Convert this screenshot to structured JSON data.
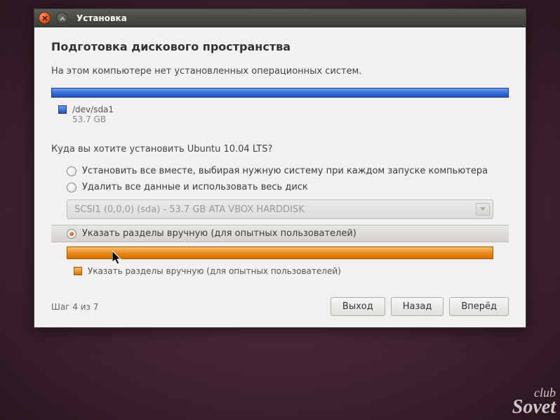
{
  "window": {
    "title": "Установка"
  },
  "header": "Подготовка дискового пространства",
  "info": "На этом компьютере нет установленных операционных систем.",
  "disk1_legend": {
    "device": "/dev/sda1",
    "size": "53.7 GB"
  },
  "question": "Куда вы хотите установить Ubuntu 10.04 LTS?",
  "options": {
    "side_by_side": "Установить все вместе, выбирая нужную систему при каждом запуске компьютера",
    "erase": "Удалить все данные и использовать весь диск",
    "manual": "Указать разделы вручную (для опытных пользователей)"
  },
  "dropdown": {
    "disabled_text": "SCSI1 (0,0,0) (sda) - 53.7 GB ATA VBOX HARDDISK"
  },
  "legend2": "Указать разделы вручную (для опытных пользователей)",
  "footer": {
    "step": "Шаг 4 из 7",
    "quit": "Выход",
    "back": "Назад",
    "forward": "Вперёд"
  },
  "watermark": {
    "line1": "club",
    "line2": "Sovet"
  }
}
